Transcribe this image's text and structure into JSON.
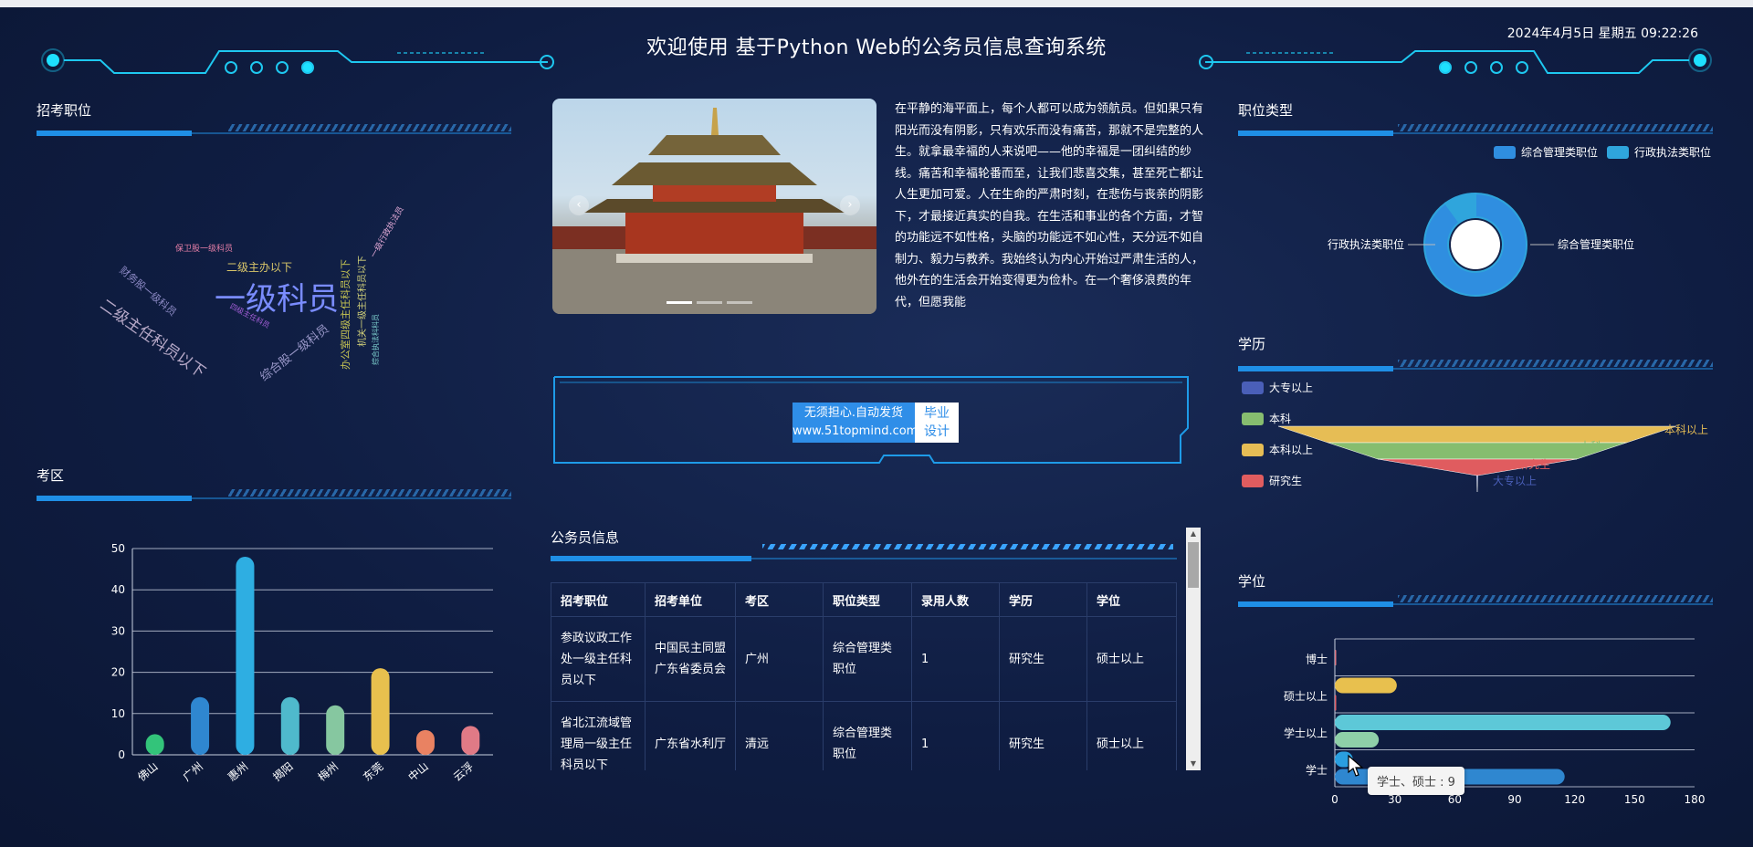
{
  "header": {
    "title": "欢迎使用 基于Python Web的公务员信息查询系统",
    "datetime": "2024年4月5日 星期五 09:22:26"
  },
  "panels": {
    "positions": "招考职位",
    "districts": "考区",
    "position_type": "职位类型",
    "education": "学历",
    "degree": "学位",
    "civil_info": "公务员信息"
  },
  "wordcloud": [
    {
      "text": "一级科员",
      "color": "#7a8cff"
    },
    {
      "text": "二级主任科员以下",
      "color": "#b7a9c8"
    },
    {
      "text": "二级主办以下",
      "color": "#d9c66a"
    },
    {
      "text": "保卫股一级科员",
      "color": "#e77fa8"
    },
    {
      "text": "财务股一级科员",
      "color": "#8c89c4"
    },
    {
      "text": "综合股一级科员",
      "color": "#9a98c9"
    },
    {
      "text": "四级主任科员",
      "color": "#a45fd8"
    },
    {
      "text": "办公室四级主任科员以下",
      "color": "#c7c552"
    },
    {
      "text": "机关一级主任科员以下",
      "color": "#d4d37a"
    },
    {
      "text": "一级行政执法员",
      "color": "#e1a9d5"
    },
    {
      "text": "综合执法科科员",
      "color": "#7fd2d0"
    }
  ],
  "intro_text": "在平静的海平面上，每个人都可以成为领航员。但如果只有阳光而没有阴影，只有欢乐而没有痛苦，那就不是完整的人生。就拿最幸福的人来说吧——他的幸福是一团纠结的纱线。痛苦和幸福轮番而至，让我们悲喜交集，甚至死亡都让人生更加可爱。人在生命的严肃时刻，在悲伤与丧亲的阴影下，才最接近真实的自我。在生活和事业的各个方面，才智的功能远不如性格，头脑的功能远不如心性，天分远不如自制力、毅力与教养。我始终认为内心开始过严肃生活的人，他外在的生活会开始变得更为俭朴。在一个奢侈浪费的年代，但愿我能",
  "watermark": {
    "line1": "无须担心.自动发货",
    "line2": "www.51topmind.com",
    "right1": "毕业",
    "right2": "设计"
  },
  "table": {
    "headers": [
      "招考职位",
      "招考单位",
      "考区",
      "职位类型",
      "录用人数",
      "学历",
      "学位"
    ],
    "rows": [
      [
        "参政议政工作处一级主任科员以下",
        "中国民主同盟广东省委员会",
        "广州",
        "综合管理类职位",
        "1",
        "研究生",
        "硕士以上"
      ],
      [
        "省北江流域管理局一级主任科员以下",
        "广东省水利厅",
        "清远",
        "综合管理类职位",
        "1",
        "研究生",
        "硕士以上"
      ]
    ]
  },
  "tooltip": {
    "text": "学士、硕士 : 9"
  },
  "chart_data": [
    {
      "type": "bar",
      "panel": "考区",
      "categories": [
        "佛山",
        "广州",
        "惠州",
        "揭阳",
        "梅州",
        "东莞",
        "中山",
        "云浮"
      ],
      "values": [
        5,
        14,
        48,
        14,
        12,
        21,
        6,
        7
      ],
      "colors": [
        "#33c47a",
        "#2f87d0",
        "#2eaee2",
        "#4fb9cc",
        "#86c7a0",
        "#e8c04e",
        "#e98262",
        "#e07a86"
      ],
      "ylim": [
        0,
        50
      ],
      "yticks": [
        0,
        10,
        20,
        30,
        40,
        50
      ]
    },
    {
      "type": "pie",
      "panel": "职位类型",
      "labels": [
        "综合管理类职位",
        "行政执法类职位"
      ],
      "values": [
        90,
        10
      ],
      "colors": [
        "#2f8ee0",
        "#2fa5dc"
      ]
    },
    {
      "type": "funnel",
      "panel": "学历",
      "labels": [
        "大专以上",
        "本科",
        "本科以上",
        "研究生"
      ],
      "values": [
        0.3,
        75,
        100,
        50
      ],
      "colors": [
        "#4a5fb8",
        "#86bd6f",
        "#e6bd55",
        "#e05c5f"
      ]
    },
    {
      "type": "bar",
      "panel": "学位",
      "orientation": "horizontal",
      "categories": [
        "学士",
        "学士以上",
        "硕士以上",
        "博士"
      ],
      "series_rows": [
        [
          {
            "label": "学士、硕士",
            "value": 9,
            "color": "#2a9fe0"
          },
          {
            "label": "学士",
            "value": 115,
            "color": "#2f87d0"
          }
        ],
        [
          {
            "label": "学士以上",
            "value": 168,
            "color": "#5dc8d8"
          },
          {
            "label": "",
            "value": 22,
            "color": "#8fd0a8"
          }
        ],
        [
          {
            "label": "硕士以上",
            "value": 31,
            "color": "#e8c04e"
          },
          {
            "label": "",
            "value": 0.5,
            "color": "#e3636b"
          }
        ],
        [
          {
            "label": "博士",
            "value": 0.5,
            "color": "#e07a86"
          }
        ]
      ],
      "xlim": [
        0,
        180
      ],
      "xticks": [
        0,
        30,
        60,
        90,
        120,
        150,
        180
      ]
    }
  ]
}
